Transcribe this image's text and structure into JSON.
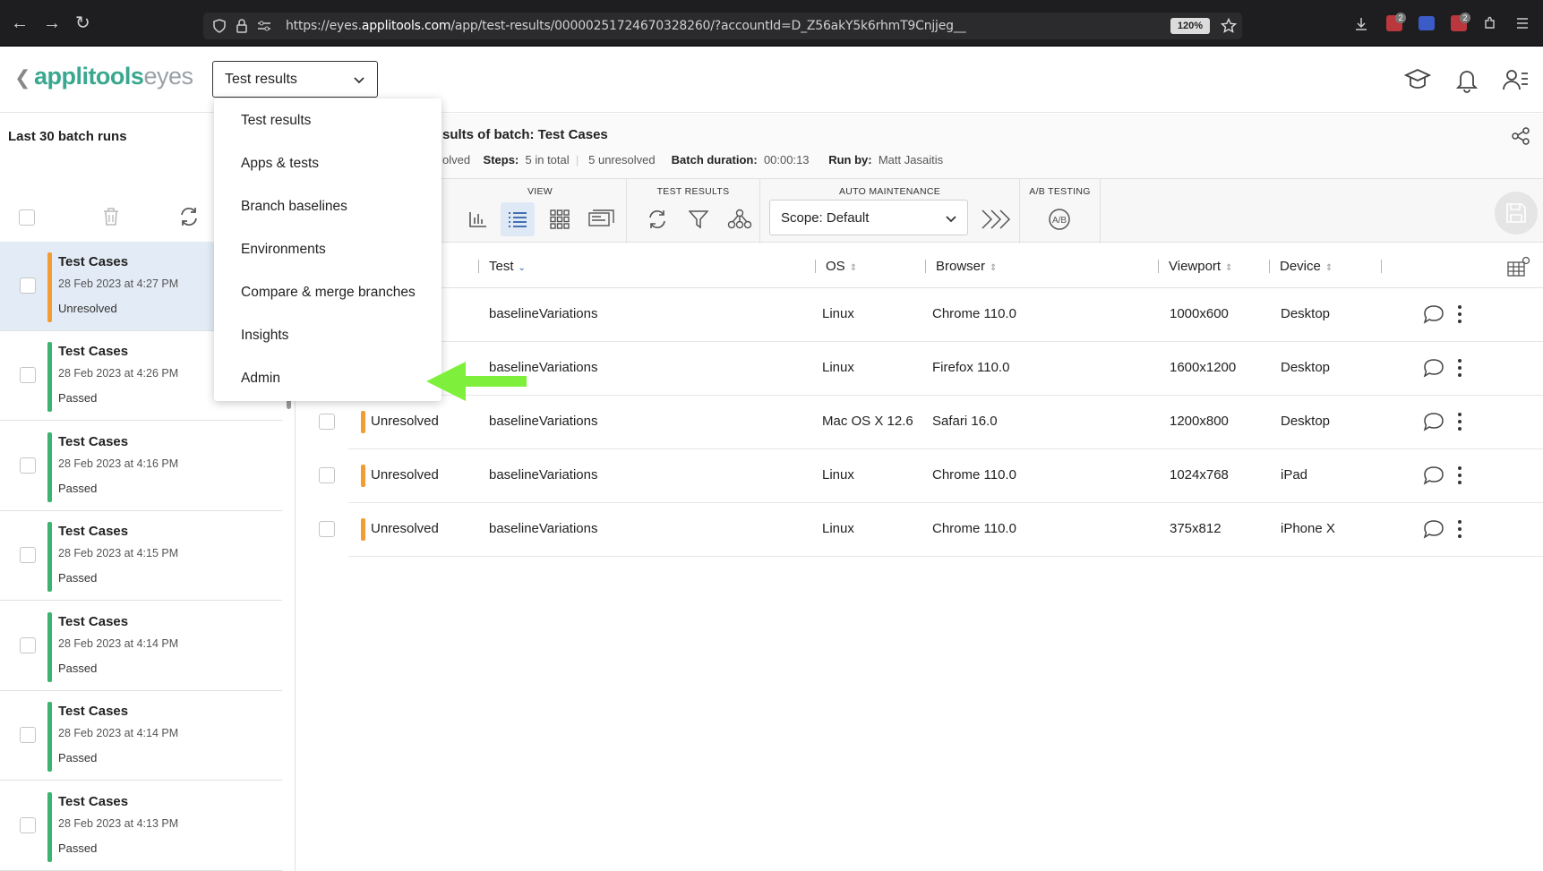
{
  "browser": {
    "url_prefix": "https://eyes.",
    "url_domain": "applitools.com",
    "url_path": "/app/test-results/00000251724670328260/?accountId=D_Z56akY5k6rhmT9Cnjjeg__",
    "zoom": "120%",
    "ext_badge_1": "2",
    "ext_badge_2": "2",
    "icons": [
      "back-icon",
      "forward-icon",
      "reload-icon",
      "shield-icon",
      "lock-icon",
      "permissions-icon",
      "star-icon",
      "download-icon",
      "extension-icon",
      "puzzle-icon",
      "menu-icon"
    ]
  },
  "header": {
    "logo_brand": "applitools",
    "logo_sub": "eyes",
    "page_select_value": "Test results",
    "icons": [
      "learning-icon",
      "notification-bell-icon",
      "user-menu-icon"
    ]
  },
  "page_menu": {
    "items": [
      "Test results",
      "Apps & tests",
      "Branch baselines",
      "Environments",
      "Compare & merge branches",
      "Insights",
      "Admin"
    ]
  },
  "sidebar": {
    "title": "Last 30 batch runs",
    "batches": [
      {
        "name": "Test Cases",
        "date": "28 Feb 2023 at 4:27 PM",
        "status": "Unresolved"
      },
      {
        "name": "Test Cases",
        "date": "28 Feb 2023 at 4:26 PM",
        "status": "Passed"
      },
      {
        "name": "Test Cases",
        "date": "28 Feb 2023 at 4:16 PM",
        "status": "Passed"
      },
      {
        "name": "Test Cases",
        "date": "28 Feb 2023 at 4:15 PM",
        "status": "Passed"
      },
      {
        "name": "Test Cases",
        "date": "28 Feb 2023 at 4:14 PM",
        "status": "Passed"
      },
      {
        "name": "Test Cases",
        "date": "28 Feb 2023 at 4:14 PM",
        "status": "Passed"
      },
      {
        "name": "Test Cases",
        "date": "28 Feb 2023 at 4:13 PM",
        "status": "Passed"
      }
    ]
  },
  "batch": {
    "title": "sults of batch:  Test Cases",
    "status_partial": "olved",
    "steps_label": "Steps:",
    "steps_value": "5 in total",
    "unresolved_value": "5 unresolved",
    "duration_label": "Batch duration:",
    "duration_value": "00:00:13",
    "runby_label": "Run by:",
    "runby_value": "Matt Jasaitis"
  },
  "toolbar": {
    "view_label": "VIEW",
    "test_results_label": "TEST RESULTS",
    "auto_maintenance_label": "AUTO MAINTENANCE",
    "ab_testing_label": "A/B TESTING",
    "scope_value": "Scope: Default",
    "ab_icon_text": "A/B"
  },
  "table": {
    "columns": [
      "Test",
      "OS",
      "Browser",
      "Viewport",
      "Device"
    ],
    "rows": [
      {
        "status": "",
        "test": "baselineVariations",
        "os": "Linux",
        "browser": "Chrome 110.0",
        "viewport": "1000x600",
        "device": "Desktop"
      },
      {
        "status": "",
        "test": "baselineVariations",
        "os": "Linux",
        "browser": "Firefox 110.0",
        "viewport": "1600x1200",
        "device": "Desktop"
      },
      {
        "status": "Unresolved",
        "test": "baselineVariations",
        "os": "Mac OS X 12.6",
        "browser": "Safari 16.0",
        "viewport": "1200x800",
        "device": "Desktop"
      },
      {
        "status": "Unresolved",
        "test": "baselineVariations",
        "os": "Linux",
        "browser": "Chrome 110.0",
        "viewport": "1024x768",
        "device": "iPad"
      },
      {
        "status": "Unresolved",
        "test": "baselineVariations",
        "os": "Linux",
        "browser": "Chrome 110.0",
        "viewport": "375x812",
        "device": "iPhone X"
      }
    ]
  },
  "colors": {
    "unresolved": "#f39c33",
    "passed": "#3cb371",
    "brand": "#3aa890",
    "arrow": "#7ef03c"
  }
}
